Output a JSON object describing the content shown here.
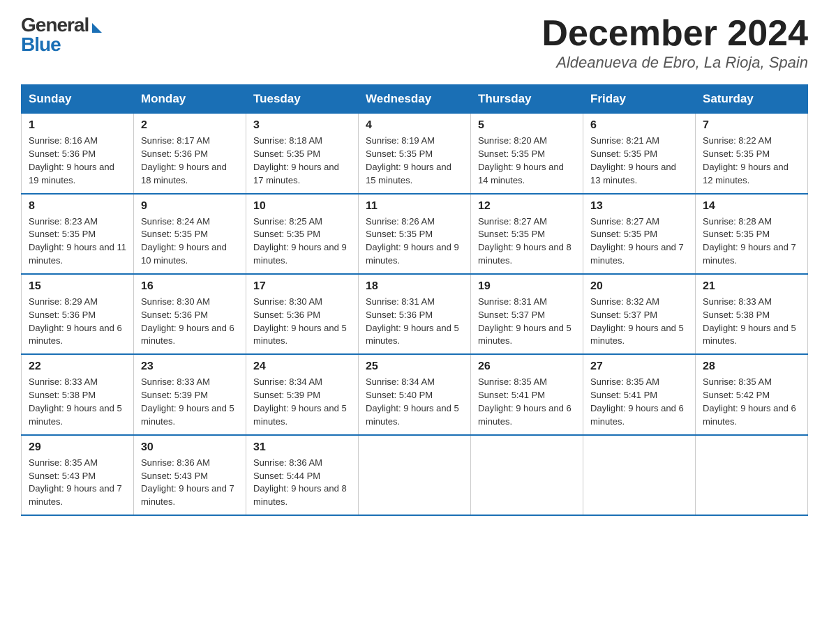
{
  "logo": {
    "general": "General",
    "blue": "Blue"
  },
  "title": "December 2024",
  "subtitle": "Aldeanueva de Ebro, La Rioja, Spain",
  "days_of_week": [
    "Sunday",
    "Monday",
    "Tuesday",
    "Wednesday",
    "Thursday",
    "Friday",
    "Saturday"
  ],
  "weeks": [
    [
      {
        "day": "1",
        "sunrise": "8:16 AM",
        "sunset": "5:36 PM",
        "daylight": "9 hours and 19 minutes."
      },
      {
        "day": "2",
        "sunrise": "8:17 AM",
        "sunset": "5:36 PM",
        "daylight": "9 hours and 18 minutes."
      },
      {
        "day": "3",
        "sunrise": "8:18 AM",
        "sunset": "5:35 PM",
        "daylight": "9 hours and 17 minutes."
      },
      {
        "day": "4",
        "sunrise": "8:19 AM",
        "sunset": "5:35 PM",
        "daylight": "9 hours and 15 minutes."
      },
      {
        "day": "5",
        "sunrise": "8:20 AM",
        "sunset": "5:35 PM",
        "daylight": "9 hours and 14 minutes."
      },
      {
        "day": "6",
        "sunrise": "8:21 AM",
        "sunset": "5:35 PM",
        "daylight": "9 hours and 13 minutes."
      },
      {
        "day": "7",
        "sunrise": "8:22 AM",
        "sunset": "5:35 PM",
        "daylight": "9 hours and 12 minutes."
      }
    ],
    [
      {
        "day": "8",
        "sunrise": "8:23 AM",
        "sunset": "5:35 PM",
        "daylight": "9 hours and 11 minutes."
      },
      {
        "day": "9",
        "sunrise": "8:24 AM",
        "sunset": "5:35 PM",
        "daylight": "9 hours and 10 minutes."
      },
      {
        "day": "10",
        "sunrise": "8:25 AM",
        "sunset": "5:35 PM",
        "daylight": "9 hours and 9 minutes."
      },
      {
        "day": "11",
        "sunrise": "8:26 AM",
        "sunset": "5:35 PM",
        "daylight": "9 hours and 9 minutes."
      },
      {
        "day": "12",
        "sunrise": "8:27 AM",
        "sunset": "5:35 PM",
        "daylight": "9 hours and 8 minutes."
      },
      {
        "day": "13",
        "sunrise": "8:27 AM",
        "sunset": "5:35 PM",
        "daylight": "9 hours and 7 minutes."
      },
      {
        "day": "14",
        "sunrise": "8:28 AM",
        "sunset": "5:35 PM",
        "daylight": "9 hours and 7 minutes."
      }
    ],
    [
      {
        "day": "15",
        "sunrise": "8:29 AM",
        "sunset": "5:36 PM",
        "daylight": "9 hours and 6 minutes."
      },
      {
        "day": "16",
        "sunrise": "8:30 AM",
        "sunset": "5:36 PM",
        "daylight": "9 hours and 6 minutes."
      },
      {
        "day": "17",
        "sunrise": "8:30 AM",
        "sunset": "5:36 PM",
        "daylight": "9 hours and 5 minutes."
      },
      {
        "day": "18",
        "sunrise": "8:31 AM",
        "sunset": "5:36 PM",
        "daylight": "9 hours and 5 minutes."
      },
      {
        "day": "19",
        "sunrise": "8:31 AM",
        "sunset": "5:37 PM",
        "daylight": "9 hours and 5 minutes."
      },
      {
        "day": "20",
        "sunrise": "8:32 AM",
        "sunset": "5:37 PM",
        "daylight": "9 hours and 5 minutes."
      },
      {
        "day": "21",
        "sunrise": "8:33 AM",
        "sunset": "5:38 PM",
        "daylight": "9 hours and 5 minutes."
      }
    ],
    [
      {
        "day": "22",
        "sunrise": "8:33 AM",
        "sunset": "5:38 PM",
        "daylight": "9 hours and 5 minutes."
      },
      {
        "day": "23",
        "sunrise": "8:33 AM",
        "sunset": "5:39 PM",
        "daylight": "9 hours and 5 minutes."
      },
      {
        "day": "24",
        "sunrise": "8:34 AM",
        "sunset": "5:39 PM",
        "daylight": "9 hours and 5 minutes."
      },
      {
        "day": "25",
        "sunrise": "8:34 AM",
        "sunset": "5:40 PM",
        "daylight": "9 hours and 5 minutes."
      },
      {
        "day": "26",
        "sunrise": "8:35 AM",
        "sunset": "5:41 PM",
        "daylight": "9 hours and 6 minutes."
      },
      {
        "day": "27",
        "sunrise": "8:35 AM",
        "sunset": "5:41 PM",
        "daylight": "9 hours and 6 minutes."
      },
      {
        "day": "28",
        "sunrise": "8:35 AM",
        "sunset": "5:42 PM",
        "daylight": "9 hours and 6 minutes."
      }
    ],
    [
      {
        "day": "29",
        "sunrise": "8:35 AM",
        "sunset": "5:43 PM",
        "daylight": "9 hours and 7 minutes."
      },
      {
        "day": "30",
        "sunrise": "8:36 AM",
        "sunset": "5:43 PM",
        "daylight": "9 hours and 7 minutes."
      },
      {
        "day": "31",
        "sunrise": "8:36 AM",
        "sunset": "5:44 PM",
        "daylight": "9 hours and 8 minutes."
      },
      null,
      null,
      null,
      null
    ]
  ]
}
